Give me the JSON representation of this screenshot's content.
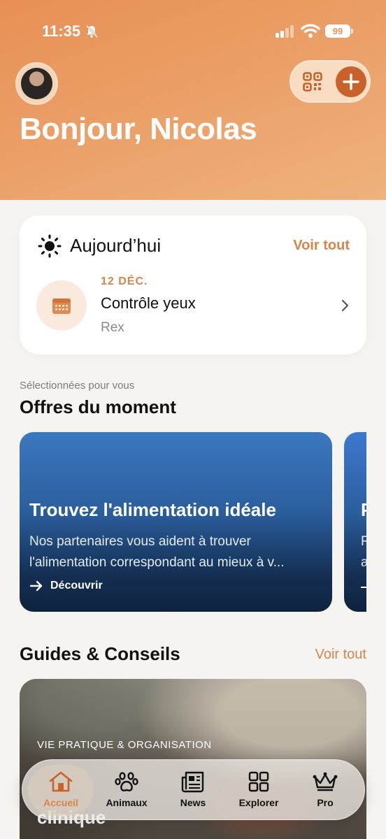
{
  "status_bar": {
    "time": "11:35",
    "battery": "99"
  },
  "header": {
    "greeting": "Bonjour, Nicolas"
  },
  "today": {
    "title": "Aujourd’hui",
    "see_all": "Voir tout",
    "event": {
      "date": "12 DÉC.",
      "title": "Contrôle yeux",
      "pet": "Rex"
    }
  },
  "offers": {
    "subtitle": "Sélectionnées pour vous",
    "title": "Offres du moment",
    "cards": [
      {
        "title": "Trouvez l'alimentation idéale",
        "desc_line1": "Nos partenaires vous aident à trouver",
        "desc_line2": "l'alimentation correspondant au mieux à v...",
        "cta": "Découvrir"
      },
      {
        "title": "P",
        "desc_line1": "R",
        "desc_line2": "a"
      }
    ]
  },
  "guides": {
    "title": "Guides & Conseils",
    "see_all": "Voir tout",
    "card": {
      "category": "VIE PRATIQUE & ORGANISATION",
      "title_tail": "clinique"
    }
  },
  "tabbar": {
    "items": [
      {
        "label": "Accueil",
        "icon": "home-icon",
        "active": true
      },
      {
        "label": "Animaux",
        "icon": "paw-icon"
      },
      {
        "label": "News",
        "icon": "newspaper-icon"
      },
      {
        "label": "Explorer",
        "icon": "grid-icon"
      },
      {
        "label": "Pro",
        "icon": "crown-icon"
      }
    ]
  },
  "colors": {
    "accent": "#d9844a",
    "header_start": "#e88f55",
    "plus_button": "#c9622a"
  }
}
